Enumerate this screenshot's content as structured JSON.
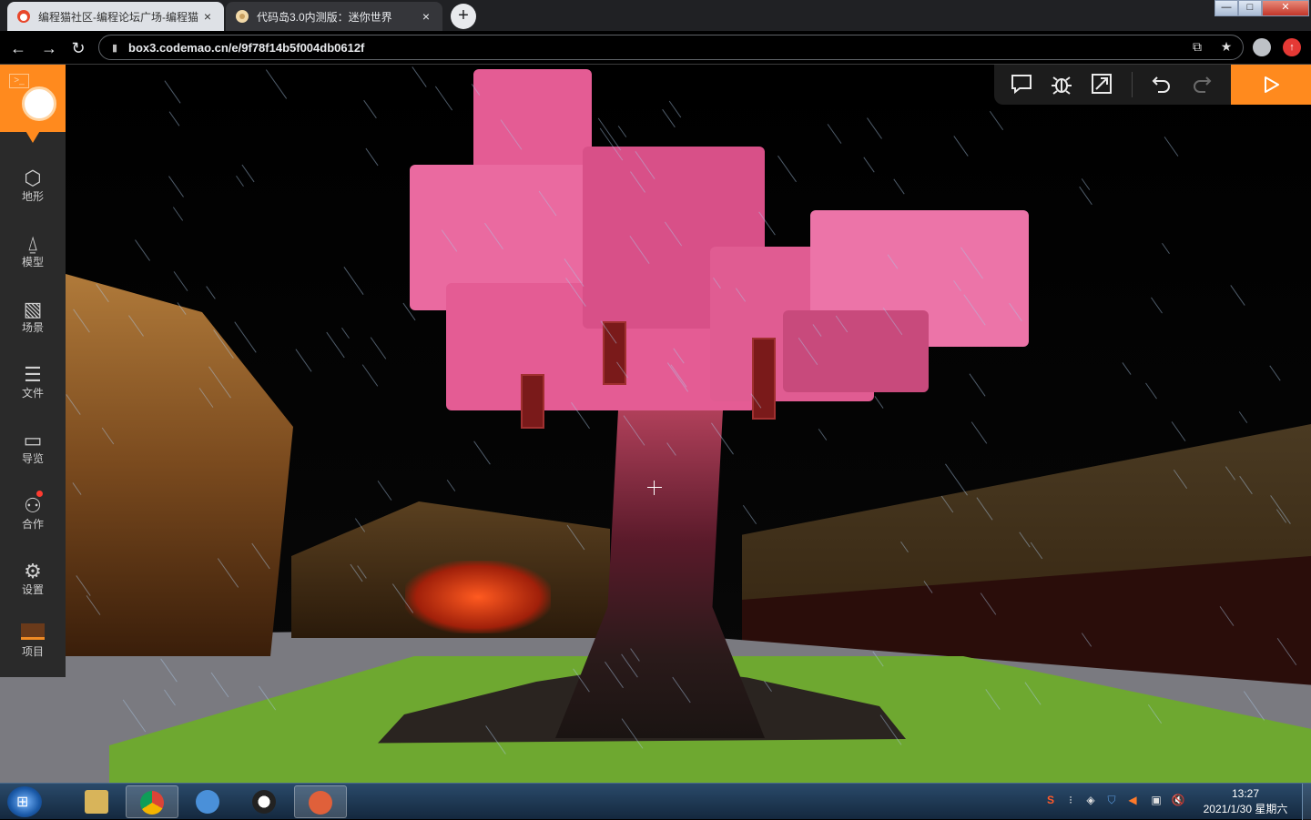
{
  "browser": {
    "tabs": [
      {
        "title": "编程猫社区-编程论坛广场-编程猫",
        "close": "×",
        "active": false
      },
      {
        "title": "代码岛3.0内测版：迷你世界",
        "close": "×",
        "active": true
      }
    ],
    "new_tab": "+",
    "window_controls": {
      "minimize": "—",
      "maximize": "□",
      "close": "✕"
    },
    "address": {
      "url": "box3.codemao.cn/e/9f78f14b5f004db0612f"
    }
  },
  "editor": {
    "sidebar": {
      "items": [
        {
          "label": "地形",
          "icon": "cube-icon",
          "glyph": "⬡"
        },
        {
          "label": "模型",
          "icon": "bell-icon",
          "glyph": "⍙"
        },
        {
          "label": "场景",
          "icon": "image-icon",
          "glyph": "▧"
        },
        {
          "label": "文件",
          "icon": "file-list-icon",
          "glyph": "☰"
        },
        {
          "label": "导览",
          "icon": "folder-icon",
          "glyph": "▭"
        },
        {
          "label": "合作",
          "icon": "users-icon",
          "glyph": "⚇",
          "badge": true
        },
        {
          "label": "设置",
          "icon": "gear-icon",
          "glyph": "⚙"
        }
      ],
      "project": {
        "label": "项目"
      }
    },
    "toolbar": {
      "comment_icon": "comment-icon",
      "debug_icon": "bug-icon",
      "expand_icon": "resize-icon",
      "undo_icon": "undo-icon",
      "redo_icon": "redo-icon",
      "run_icon": "play-icon"
    }
  },
  "taskbar": {
    "apps": [
      {
        "name": "file-explorer-icon",
        "color": "#d8b45a"
      },
      {
        "name": "chrome-icon",
        "color": "#db4437",
        "active": true
      },
      {
        "name": "paint-icon",
        "color": "#4a90d9"
      },
      {
        "name": "qq-icon",
        "color": "#222222"
      },
      {
        "name": "codemao-icon",
        "color": "#e0603a",
        "active": true
      }
    ],
    "clock": {
      "time": "13:27",
      "date": "2021/1/30 星期六"
    }
  },
  "colors": {
    "accent": "#ff8a1e",
    "blossom": "#e45c94",
    "sidebar_bg": "#2a2a2a"
  }
}
